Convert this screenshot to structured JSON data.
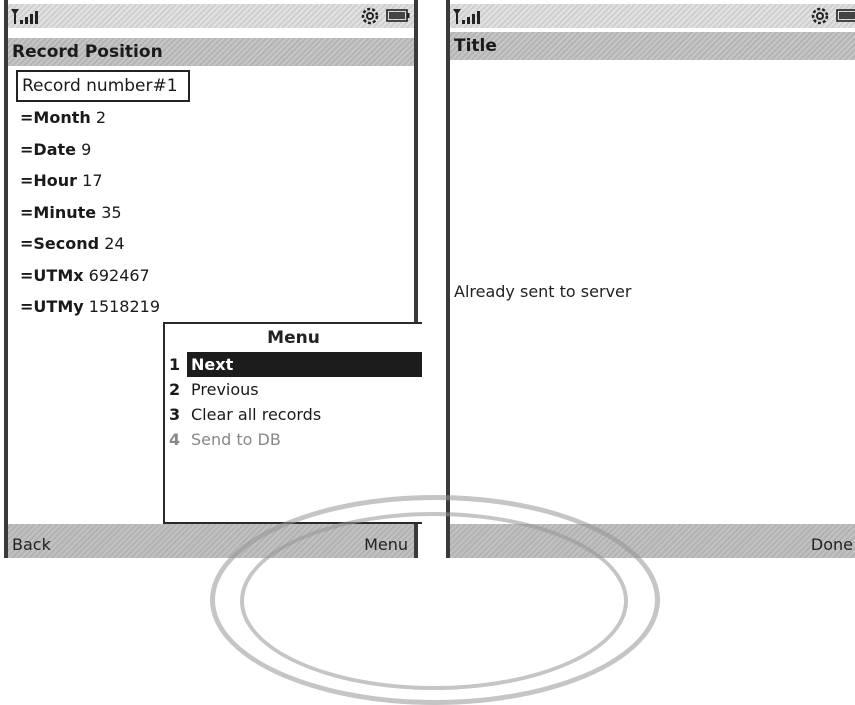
{
  "left_screen": {
    "title": "Record Position",
    "record_field": "Record number#1",
    "fields": [
      {
        "label": "=Month",
        "value": "2"
      },
      {
        "label": "=Date",
        "value": "9"
      },
      {
        "label": "=Hour",
        "value": "17"
      },
      {
        "label": "=Minute",
        "value": "35"
      },
      {
        "label": "=Second",
        "value": "24"
      },
      {
        "label": "=UTMx",
        "value": "692467"
      },
      {
        "label": "=UTMy",
        "value": "1518219"
      }
    ],
    "menu": {
      "title": "Menu",
      "items": [
        {
          "num": "1",
          "label": "Next"
        },
        {
          "num": "2",
          "label": "Previous"
        },
        {
          "num": "3",
          "label": "Clear all records"
        },
        {
          "num": "4",
          "label": "Send to DB"
        }
      ]
    },
    "softkeys": {
      "left": "Back",
      "right": "Menu"
    }
  },
  "right_screen": {
    "title": "Title",
    "message": "Already sent to server",
    "softkeys": {
      "right": "Done"
    }
  },
  "icons": [
    "signal-icon",
    "settings-icon",
    "battery-icon"
  ],
  "colors": {
    "titlebar": "#b8b8b8",
    "selected_item": "#1c1c1c",
    "frame": "#3a3a3a"
  }
}
